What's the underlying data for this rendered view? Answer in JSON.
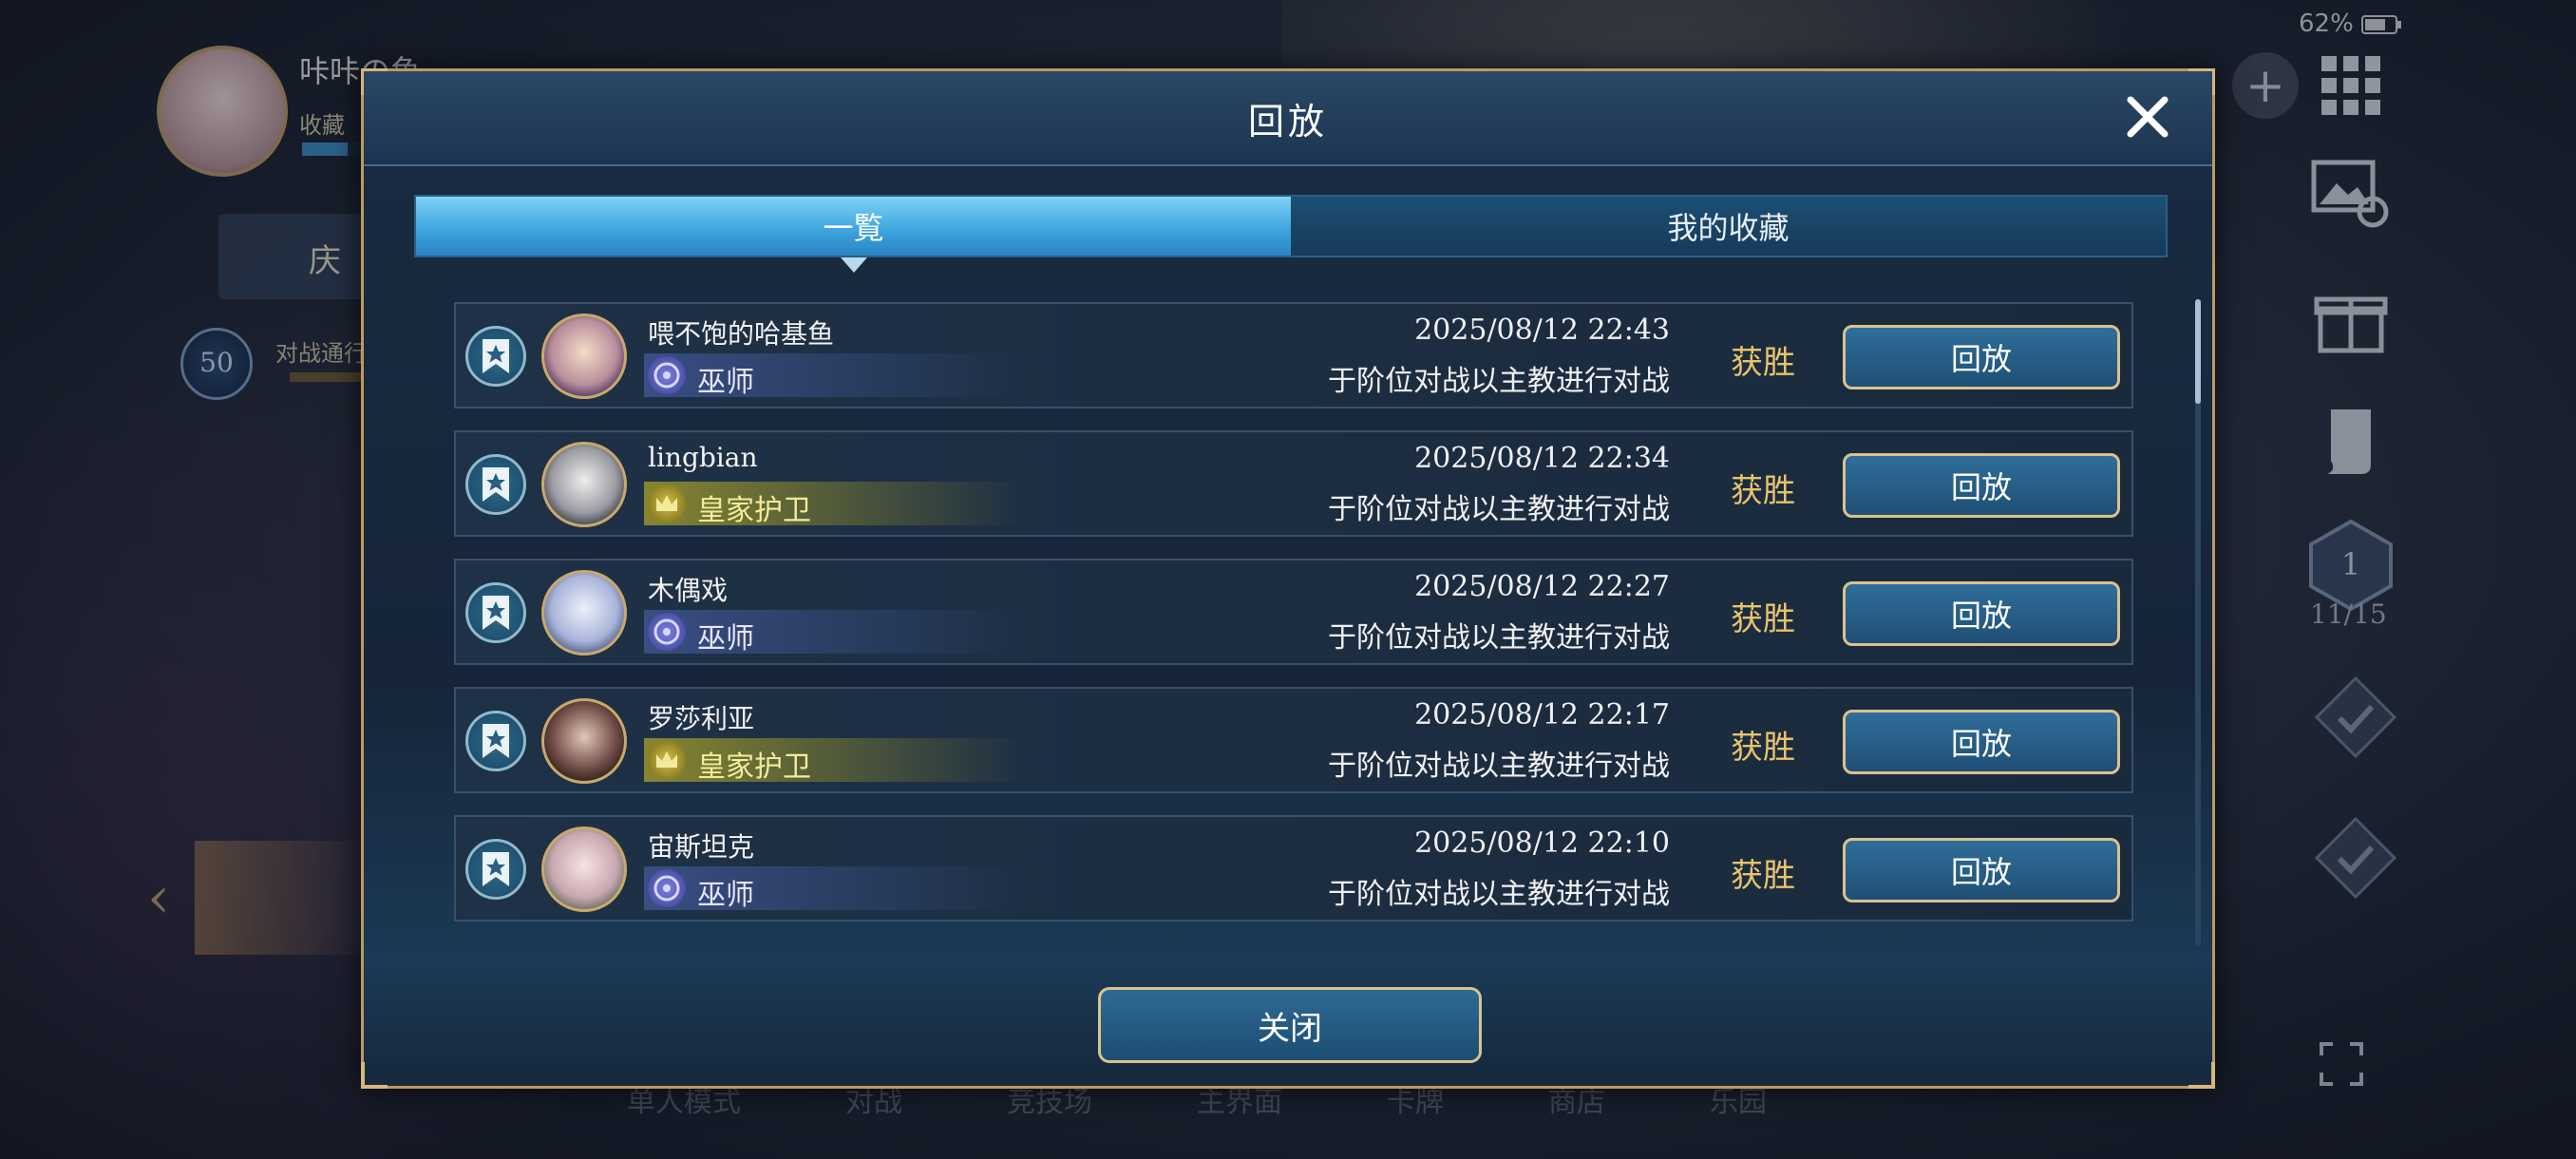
{
  "status": {
    "battery": "62%"
  },
  "background": {
    "player_name": "咔咔の鱼",
    "collection_label": "收藏",
    "celebrate_label": "庆",
    "pass_level": "50",
    "pass_label": "对战通行证",
    "quest_progress": "11/15",
    "quest_badge": "1",
    "bottom_nav": [
      "单人模式",
      "对战",
      "竞技场",
      "主界面",
      "卡牌",
      "商店",
      "乐园"
    ]
  },
  "modal": {
    "title": "回放",
    "tabs": [
      {
        "label": "一覧",
        "active": true
      },
      {
        "label": "我的收藏",
        "active": false
      }
    ],
    "close_label": "关闭",
    "replay_label": "回放",
    "matches": [
      {
        "player": "喂不饱的哈基鱼",
        "class": "巫师",
        "class_type": "wizard",
        "time": "2025/08/12  22:43",
        "mode": "于阶位对战以主教进行对战",
        "result": "获胜"
      },
      {
        "player": "lingbian",
        "class": "皇家护卫",
        "class_type": "royal",
        "time": "2025/08/12  22:34",
        "mode": "于阶位对战以主教进行对战",
        "result": "获胜"
      },
      {
        "player": "木偶戏",
        "class": "巫师",
        "class_type": "wizard",
        "time": "2025/08/12  22:27",
        "mode": "于阶位对战以主教进行对战",
        "result": "获胜"
      },
      {
        "player": "罗莎利亚",
        "class": "皇家护卫",
        "class_type": "royal",
        "time": "2025/08/12  22:17",
        "mode": "于阶位对战以主教进行对战",
        "result": "获胜"
      },
      {
        "player": "宙斯坦克",
        "class": "巫师",
        "class_type": "wizard",
        "time": "2025/08/12  22:10",
        "mode": "于阶位对战以主教进行对战",
        "result": "获胜"
      }
    ]
  },
  "colors": {
    "win": "#e8c36b",
    "gold_border": "#b99a63",
    "wizard_strip": "#3a4f86",
    "royal_strip": "#8c8a2e"
  }
}
